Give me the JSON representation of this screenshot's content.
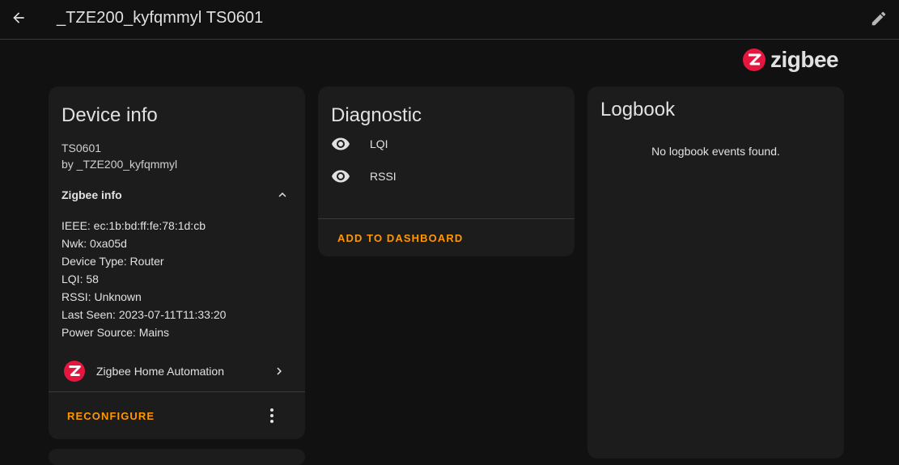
{
  "header": {
    "title": "_TZE200_kyfqmmyl TS0601"
  },
  "brand": {
    "logo_text": "zigbee",
    "accent": "#e5173f"
  },
  "device_info": {
    "title": "Device info",
    "model": "TS0601",
    "manufacturer": "by _TZE200_kyfqmmyl",
    "zigbee_info_label": "Zigbee info",
    "details": [
      "IEEE: ec:1b:bd:ff:fe:78:1d:cb",
      "Nwk: 0xa05d",
      "Device Type: Router",
      "LQI: 58",
      "RSSI: Unknown",
      "Last Seen: 2023-07-11T11:33:20",
      "Power Source: Mains"
    ],
    "integration_label": "Zigbee Home Automation",
    "reconfigure_label": "RECONFIGURE"
  },
  "diagnostic": {
    "title": "Diagnostic",
    "entities": [
      "LQI",
      "RSSI"
    ],
    "add_to_dashboard_label": "ADD TO DASHBOARD"
  },
  "logbook": {
    "title": "Logbook",
    "empty_text": "No logbook events found."
  },
  "colors": {
    "accent": "#ff9800",
    "background": "#111111",
    "card": "#1c1c1c"
  }
}
